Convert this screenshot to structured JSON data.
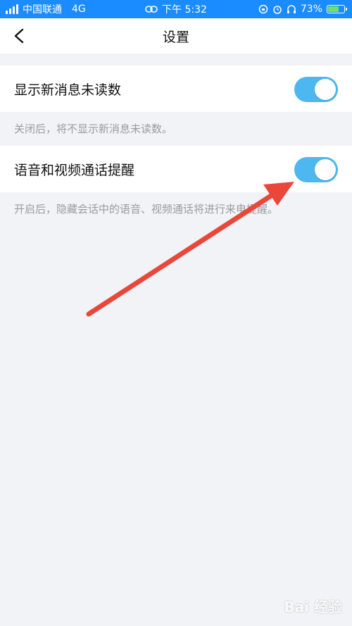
{
  "status_bar": {
    "carrier": "中国联通",
    "network": "4G",
    "time": "下午 5:32",
    "battery_level": "73%",
    "battery_fraction": 0.73
  },
  "header": {
    "title": "设置",
    "back_icon": "chevron-left-icon"
  },
  "settings": [
    {
      "label": "显示新消息未读数",
      "enabled": true,
      "hint": "关闭后，将不显示新消息未读数。"
    },
    {
      "label": "语音和视频通话提醒",
      "enabled": true,
      "hint": "开启后，隐藏会话中的语音、视频通话将进行来电提醒。"
    }
  ],
  "colors": {
    "status_bar": "#1A8CFF",
    "toggle_on": "#4DB8F0",
    "arrow": "#E8473A",
    "page_background": "#F2F3F7"
  },
  "watermark": "Bai 经验"
}
